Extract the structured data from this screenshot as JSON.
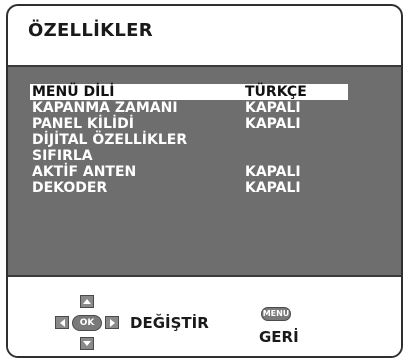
{
  "header": {
    "title": "ÖZELLİKLER"
  },
  "menu": {
    "items": [
      {
        "label": "MENÜ DİLİ",
        "value": "TÜRKÇE",
        "selected": true
      },
      {
        "label": "KAPANMA ZAMANI",
        "value": "KAPALI",
        "selected": false
      },
      {
        "label": "PANEL KİLİDİ",
        "value": "KAPALI",
        "selected": false
      },
      {
        "label": "DİJİTAL ÖZELLİKLER",
        "value": "",
        "selected": false
      },
      {
        "label": "SIFIRLA",
        "value": "",
        "selected": false
      },
      {
        "label": "AKTİF ANTEN",
        "value": "KAPALI",
        "selected": false
      },
      {
        "label": "DEKODER",
        "value": "KAPALI",
        "selected": false
      }
    ]
  },
  "footer": {
    "ok_label": "OK",
    "change_label": "DEĞİŞTİR",
    "menu_button_label": "MENU",
    "back_label": "GERİ"
  },
  "colors": {
    "panel": "#6e6e6e",
    "text_on_panel": "#ffffff",
    "selected_background": "#ffffff",
    "selected_text": "#111111"
  },
  "icons": {
    "dpad": "navigation-dpad-icon",
    "menu": "menu-button-icon"
  }
}
